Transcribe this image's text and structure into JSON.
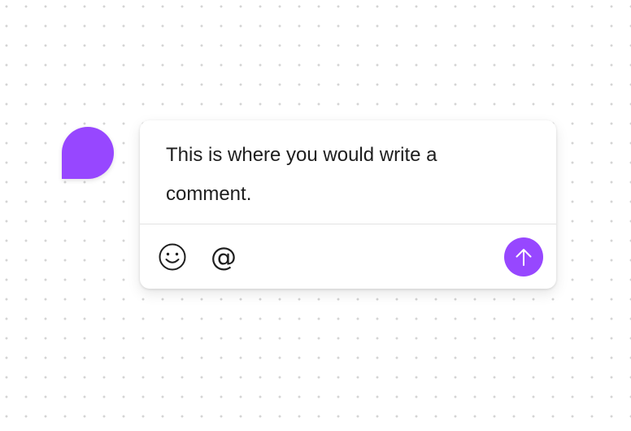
{
  "comment": {
    "text": "This is where you would write a comment.",
    "accent_color": "#9747ff"
  },
  "toolbar": {
    "emoji_icon": "smiley-icon",
    "mention_label": "@",
    "send_icon": "arrow-up-icon"
  }
}
